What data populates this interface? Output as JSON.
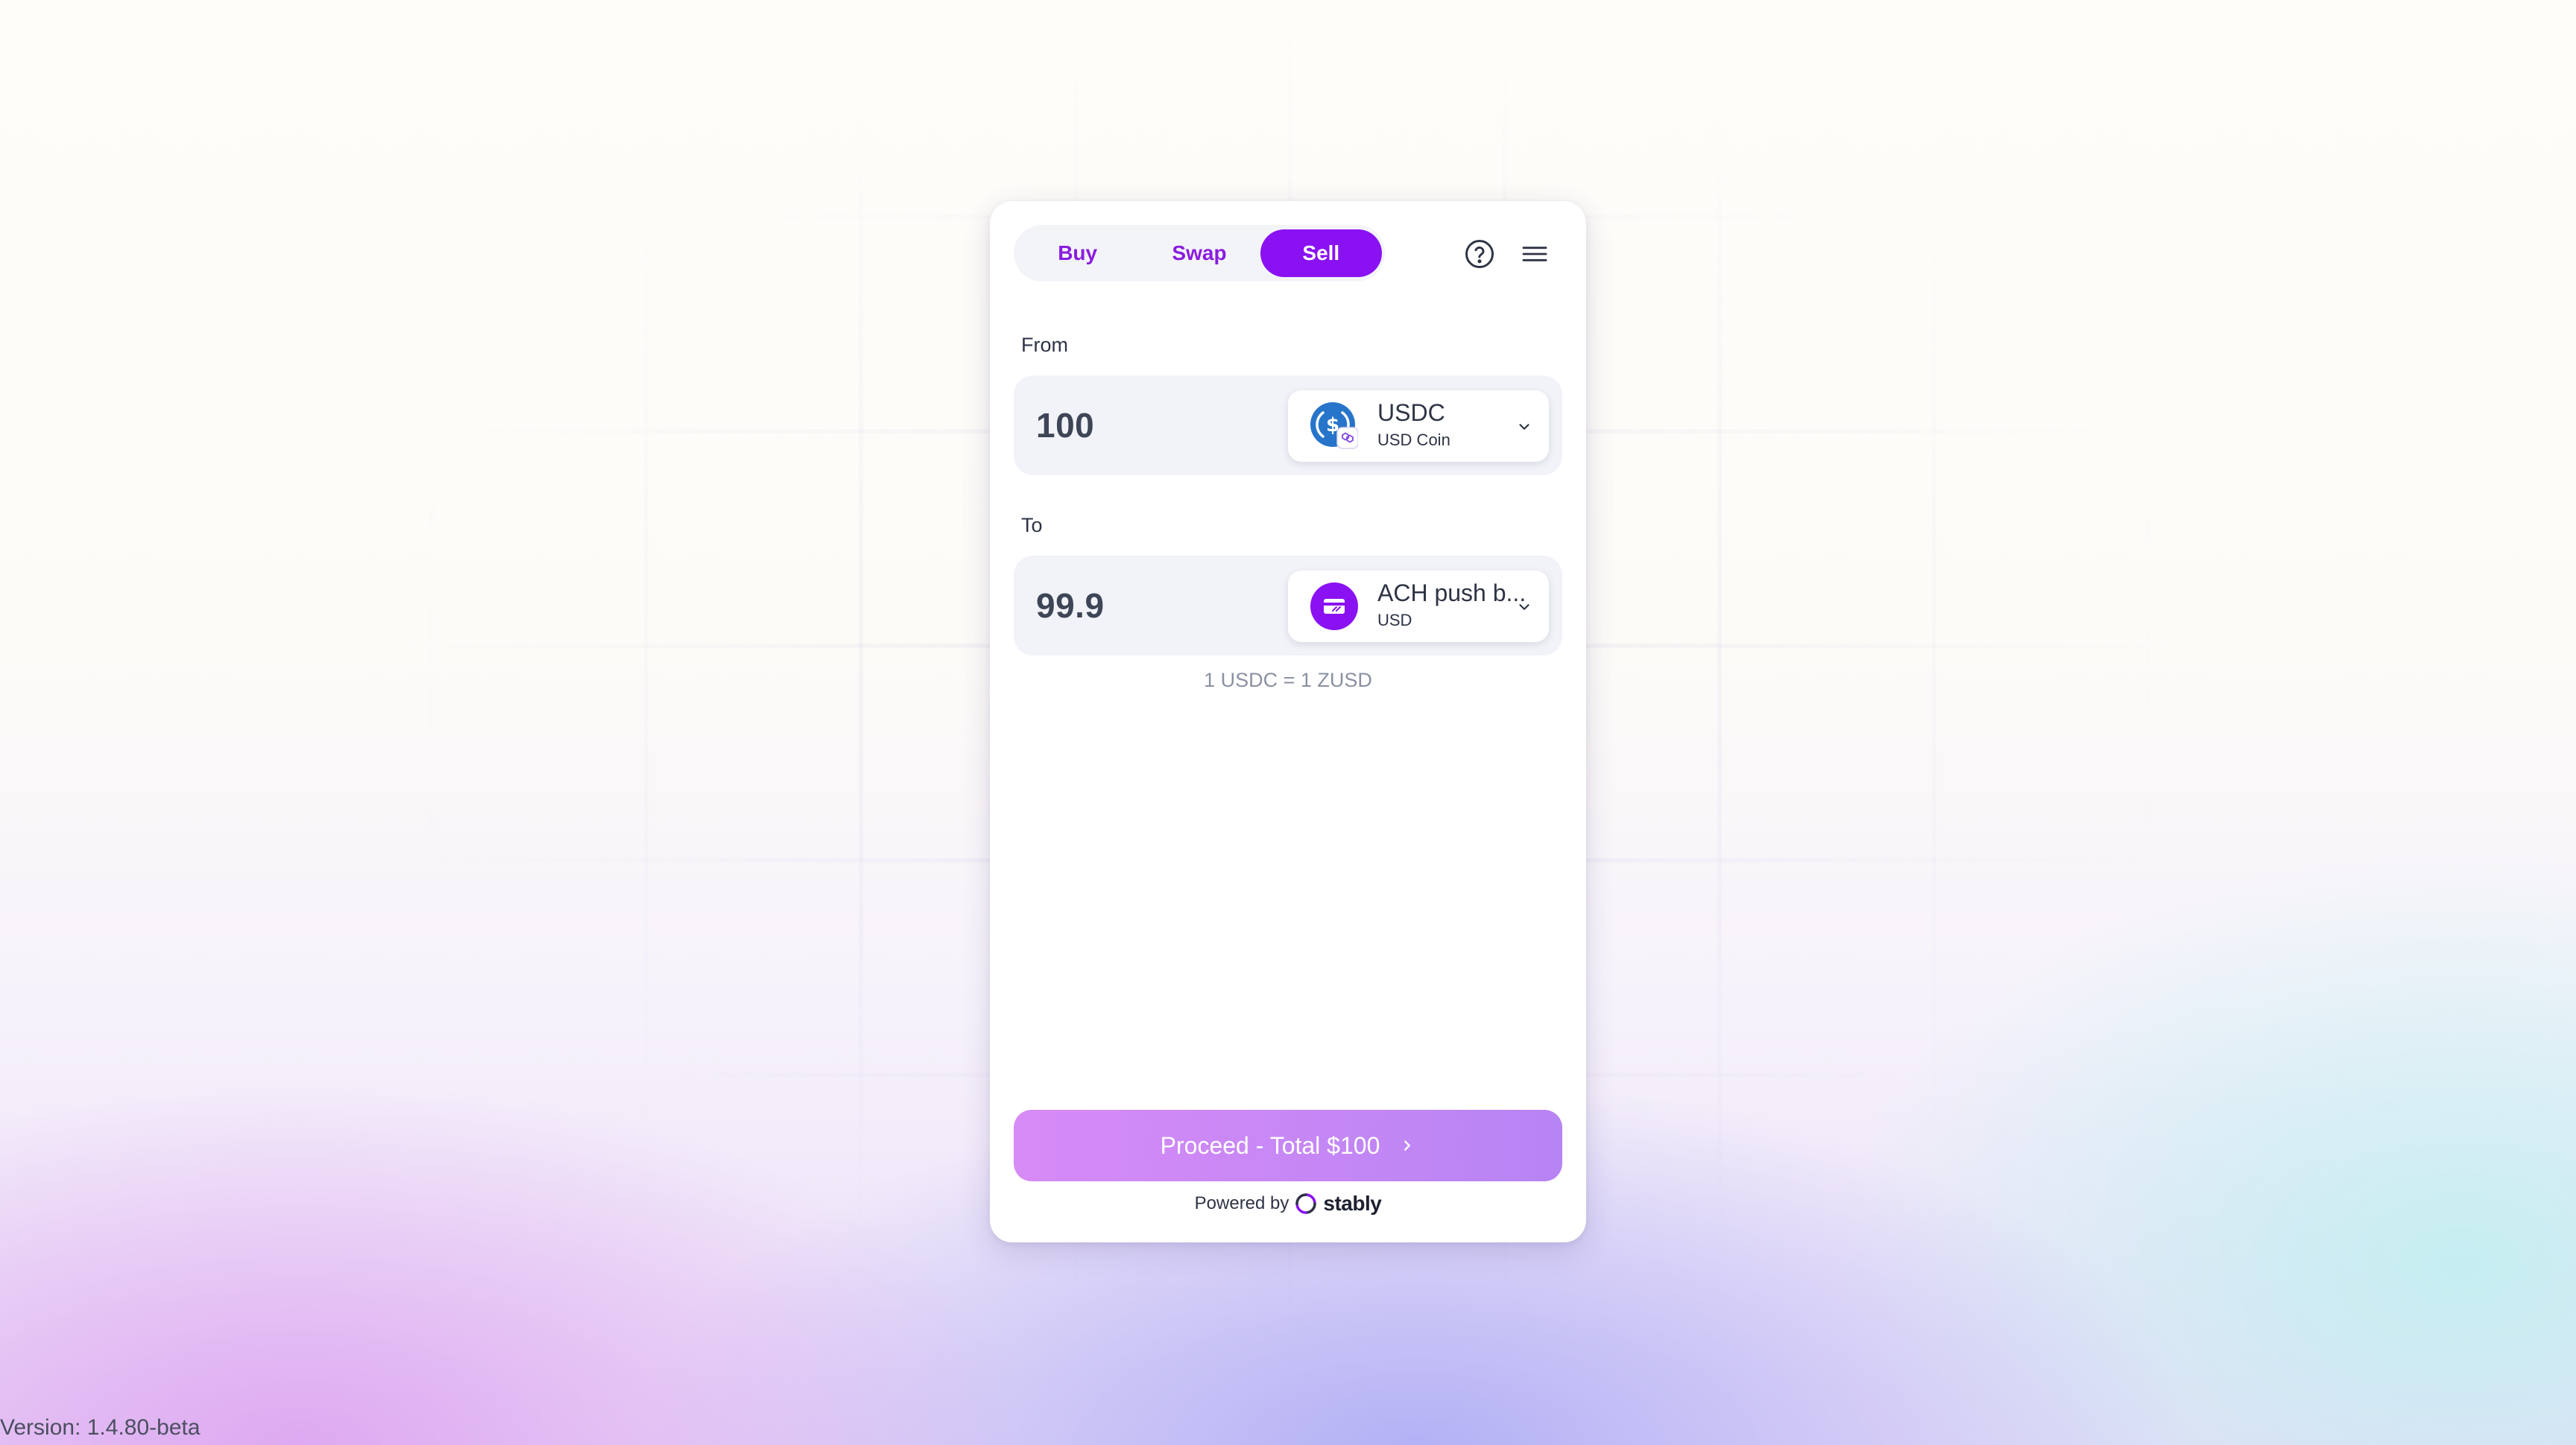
{
  "tabs": [
    {
      "label": "Buy",
      "active": false
    },
    {
      "label": "Swap",
      "active": false
    },
    {
      "label": "Sell",
      "active": true
    }
  ],
  "header": {
    "help_icon": "help-circle-icon",
    "menu_icon": "hamburger-menu-icon"
  },
  "from": {
    "label": "From",
    "amount": "100",
    "asset": {
      "name": "USDC",
      "subtitle": "USD Coin",
      "icon": "usdc-coin-icon",
      "badge_icon": "polygon-network-icon"
    }
  },
  "to": {
    "label": "To",
    "amount": "99.9",
    "asset": {
      "name": "ACH push b...",
      "subtitle": "USD",
      "icon": "bank-card-icon"
    }
  },
  "rate": "1 USDC = 1 ZUSD",
  "proceed_label": "Proceed - Total $100",
  "powered_by": {
    "prefix": "Powered by",
    "brand": "stably"
  },
  "version": "Version: 1.4.80-beta",
  "colors": {
    "accent": "#8a12f2",
    "proceed_start": "#d78bf6",
    "proceed_end": "#b784f4",
    "usdc_blue": "#2775ca",
    "text": "#2e3445",
    "muted": "#8a91a3"
  }
}
